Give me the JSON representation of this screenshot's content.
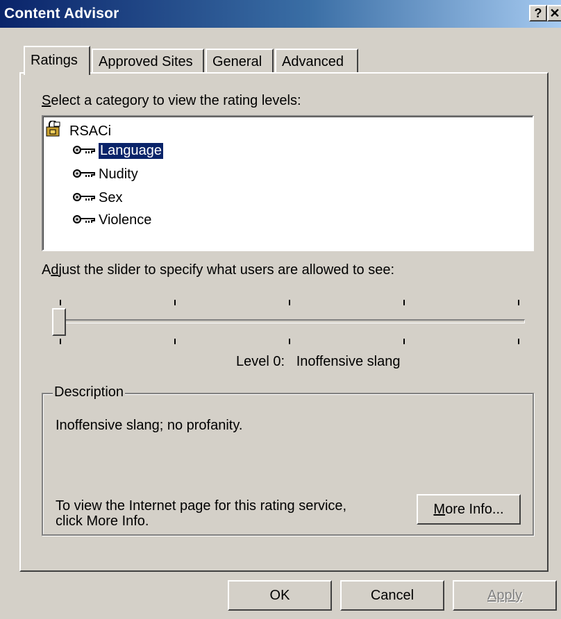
{
  "window": {
    "title": "Content Advisor",
    "help_glyph": "?",
    "close_glyph": "✕"
  },
  "tabs": [
    {
      "label": "Ratings",
      "active": true
    },
    {
      "label": "Approved Sites",
      "active": false
    },
    {
      "label": "General",
      "active": false
    },
    {
      "label": "Advanced",
      "active": false
    }
  ],
  "ratings": {
    "category_label_prefix": "S",
    "category_label_rest": "elect a category to view the rating levels:",
    "tree": {
      "root": "RSACi",
      "items": [
        "Language",
        "Nudity",
        "Sex",
        "Violence"
      ],
      "selected_index": 0
    },
    "slider_label_a": "A",
    "slider_label_u": "d",
    "slider_label_rest": "just the slider to specify what users are allowed to see:",
    "slider": {
      "level": 0,
      "max_level": 4
    },
    "level_text": "Level 0:   Inoffensive slang"
  },
  "description": {
    "title": "Description",
    "text": "Inoffensive slang; no profanity.",
    "info_line1": "To view the Internet page for this rating service,",
    "info_line2": "click More Info.",
    "more_info_u": "M",
    "more_info_rest": "ore Info..."
  },
  "buttons": {
    "ok": "OK",
    "cancel": "Cancel",
    "apply": "Apply"
  },
  "colors": {
    "title_bar_start": "#0a246a",
    "selection": "#0a246a",
    "face": "#d4d0c8"
  }
}
